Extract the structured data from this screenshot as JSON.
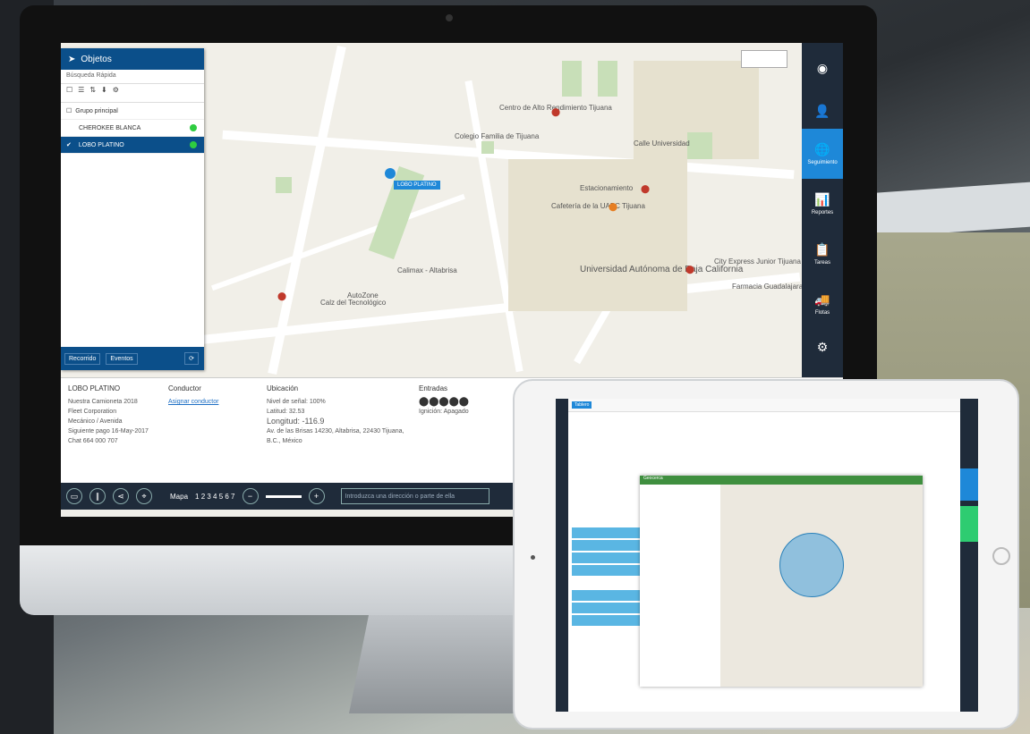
{
  "objects_panel": {
    "title": "Objetos",
    "search_placeholder": "Búsqueda Rápida",
    "group": "Grupo principal",
    "items": [
      {
        "label": "CHEROKEE BLANCA",
        "selected": false
      },
      {
        "label": "LOBO PLATINO",
        "selected": true
      }
    ],
    "footer_buttons": [
      "Recorrido",
      "Eventos"
    ]
  },
  "map": {
    "labels": [
      "Centro de Alto Rendimiento Tijuana",
      "Colegio Familia de Tijuana",
      "Estacionamiento",
      "Cafetería de la UABC Tijuana",
      "Universidad Autónoma de Baja California",
      "Calimax - Altabrisa",
      "AutoZone",
      "Calz del Tecnológico",
      "Calle Universidad",
      "City Express Junior Tijuana Otay Univ.",
      "Farmacia Guadalajara",
      "LOBO PLATINO"
    ]
  },
  "sidebar": {
    "items": [
      {
        "label": "Seguimiento",
        "icon": "globe-icon",
        "active": true
      },
      {
        "label": "Reportes",
        "icon": "report-icon",
        "active": false
      },
      {
        "label": "Tareas",
        "icon": "clipboard-icon",
        "active": false
      },
      {
        "label": "Flotas",
        "icon": "truck-icon",
        "active": false
      }
    ]
  },
  "info": {
    "unit_name": "LOBO PLATINO",
    "unit_lines": [
      "Nuestra Camioneta 2018",
      "Fleet Corporation",
      "Mecánico / Avenida",
      "Siguiente pago 16-May-2017",
      "Chat 664 000 707"
    ],
    "driver_title": "Conductor",
    "driver_link": "Asignar conductor",
    "location_title": "Ubicación",
    "location_lines": [
      "Nivel de señal: 100%",
      "Latitud: 32.53",
      "Longitud: -116.9",
      "Av. de las Brisas 14230, Altabrisa, 22430 Tijuana, B.C., México"
    ],
    "inputs_title": "Entradas",
    "inputs_status": "Ignición: Apagado"
  },
  "bottom_bar": {
    "map_label": "Mapa",
    "map_pages": "1 2 3 4 5 6 7",
    "search_placeholder": "Introduzca una dirección o parte de ella"
  },
  "tablet": {
    "modal_title": "Geocerca",
    "header_tab": "Tablero"
  }
}
